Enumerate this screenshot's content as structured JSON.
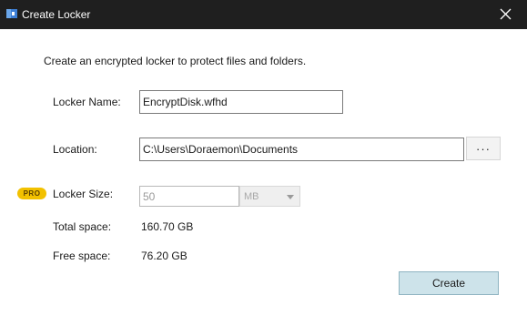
{
  "window": {
    "title": "Create Locker",
    "app_icon": "locker-app-icon",
    "close_icon": "close-icon"
  },
  "intro": "Create an encrypted locker to protect files and folders.",
  "locker_name": {
    "label": "Locker Name:",
    "value": "EncryptDisk.wfhd"
  },
  "location": {
    "label": "Location:",
    "value": "C:\\Users\\Doraemon\\Documents",
    "browse_label": "···"
  },
  "locker_size": {
    "badge": "PRO",
    "label": "Locker Size:",
    "value": "50",
    "unit": "MB",
    "enabled": false
  },
  "total_space": {
    "label": "Total space:",
    "value": "160.70 GB"
  },
  "free_space": {
    "label": "Free space:",
    "value": "76.20 GB"
  },
  "create_button": "Create",
  "colors": {
    "titlebar": "#1f1f1f",
    "pro_badge": "#f2c100",
    "create_button": "#cde3ea"
  }
}
